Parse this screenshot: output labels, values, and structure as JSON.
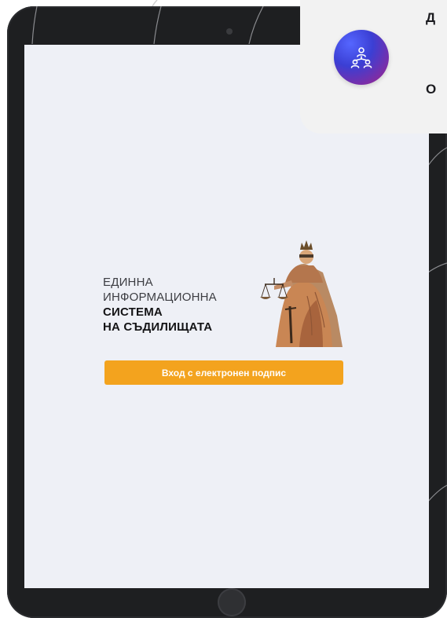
{
  "callout": {
    "line1": "Д",
    "line2": "О",
    "icon": "people-network-icon"
  },
  "logo": {
    "line1": "ЕДИННА",
    "line2": "ИНФОРМАЦИОННА",
    "line3": "СИСТЕМА",
    "line4": "НА СЪДИЛИЩАТА",
    "image": "lady-justice-fresco"
  },
  "login": {
    "button_label": "Вход с електронен подпис"
  },
  "colors": {
    "accent": "#f3a31e",
    "screen": "#eef0f6",
    "bezel": "#1e1f21",
    "badge_start": "#3b3fd4",
    "badge_end": "#b0207a"
  }
}
